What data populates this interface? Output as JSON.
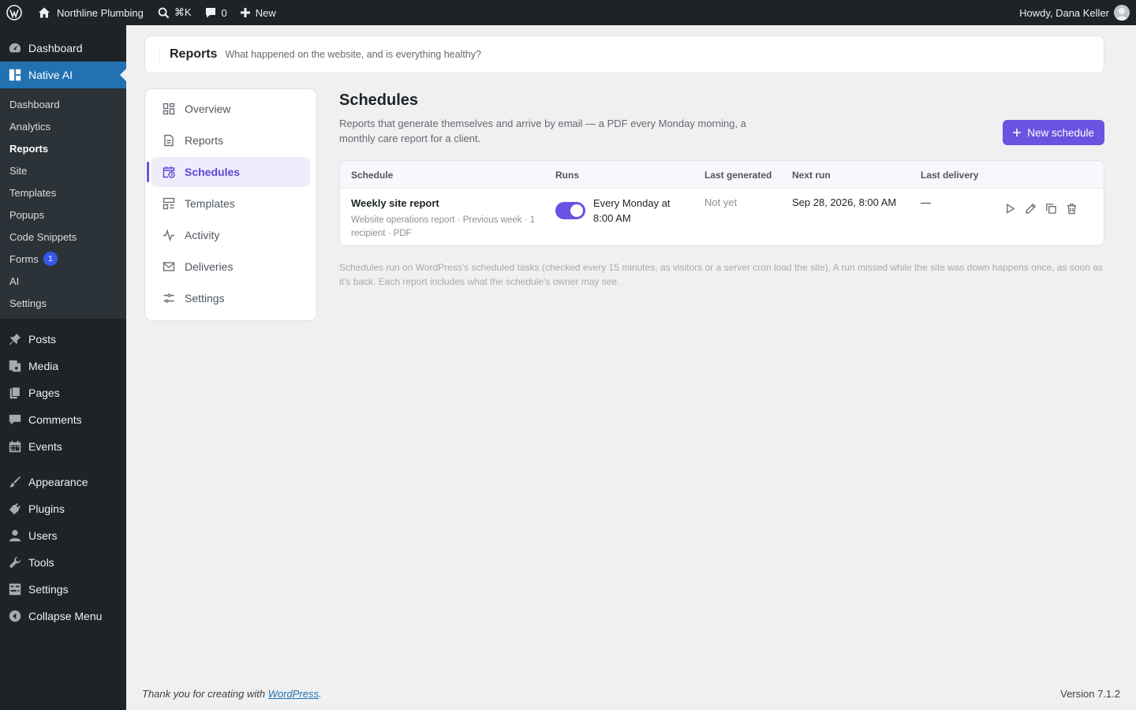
{
  "adminbar": {
    "site_name": "Northline Plumbing",
    "search_shortcut": "⌘K",
    "comments_count": "0",
    "new_label": "New",
    "howdy": "Howdy, Dana Keller"
  },
  "sidebar": {
    "top": [
      {
        "label": "Dashboard",
        "icon": "gauge-icon"
      },
      {
        "label": "Native AI",
        "icon": "grid-icon"
      }
    ],
    "native_ai_sub": [
      {
        "label": "Dashboard"
      },
      {
        "label": "Analytics"
      },
      {
        "label": "Reports"
      },
      {
        "label": "Site"
      },
      {
        "label": "Templates"
      },
      {
        "label": "Popups"
      },
      {
        "label": "Code Snippets"
      },
      {
        "label": "Forms",
        "badge": "1"
      },
      {
        "label": "AI"
      },
      {
        "label": "Settings"
      }
    ],
    "content_menu": [
      {
        "label": "Posts"
      },
      {
        "label": "Media"
      },
      {
        "label": "Pages"
      },
      {
        "label": "Comments"
      },
      {
        "label": "Events"
      }
    ],
    "admin_menu": [
      {
        "label": "Appearance"
      },
      {
        "label": "Plugins"
      },
      {
        "label": "Users"
      },
      {
        "label": "Tools"
      },
      {
        "label": "Settings"
      }
    ],
    "collapse_label": "Collapse Menu"
  },
  "header": {
    "title": "Reports",
    "description": "What happened on the website, and is everything healthy?"
  },
  "subnav": [
    {
      "label": "Overview"
    },
    {
      "label": "Reports"
    },
    {
      "label": "Schedules"
    },
    {
      "label": "Templates"
    },
    {
      "label": "Activity"
    },
    {
      "label": "Deliveries"
    },
    {
      "label": "Settings"
    }
  ],
  "main": {
    "title": "Schedules",
    "lead": "Reports that generate themselves and arrive by email — a PDF every Monday morning, a monthly care report for a client.",
    "new_button": "New schedule",
    "columns": [
      "Schedule",
      "Runs",
      "Last generated",
      "Next run",
      "Last delivery"
    ],
    "row": {
      "name": "Weekly site report",
      "meta": "Website operations report · Previous week · 1 recipient · PDF",
      "enabled": true,
      "runs": "Every Monday at 8:00 AM",
      "last_generated": "Not yet",
      "next_run": "Sep 28, 2026, 8:00 AM",
      "last_delivery": "—"
    },
    "footnote": "Schedules run on WordPress's scheduled tasks (checked every 15 minutes, as visitors or a server cron load the site). A run missed while the site was down happens once, as soon as it's back. Each report includes what the schedule's owner may see."
  },
  "footer": {
    "thanks_prefix": "Thank you for creating with ",
    "thanks_link": "WordPress",
    "thanks_suffix": ".",
    "version": "Version 7.1.2"
  },
  "colors": {
    "accent": "#6b52e0",
    "wp_blue": "#2271b1",
    "admin_dark": "#1d2327"
  }
}
